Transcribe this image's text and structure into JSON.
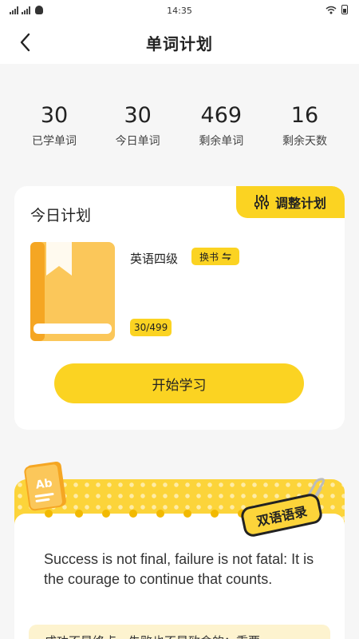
{
  "status_bar": {
    "time": "14:35"
  },
  "header": {
    "title": "单词计划"
  },
  "stats": [
    {
      "value": "30",
      "label": "已学单词"
    },
    {
      "value": "30",
      "label": "今日单词"
    },
    {
      "value": "469",
      "label": "剩余单词"
    },
    {
      "value": "16",
      "label": "剩余天数"
    }
  ],
  "plan": {
    "title": "今日计划",
    "adjust_label": "调整计划",
    "book_name": "英语四级",
    "swap_label": "换书",
    "progress": "30/499",
    "start_label": "开始学习"
  },
  "quote": {
    "tag": "双语语录",
    "english": "Success is not final, failure is not fatal: It is the courage to continue that counts.",
    "chinese": "成功不是终点，失败也不是致命的：重要"
  },
  "colors": {
    "accent": "#fbd322",
    "book_orange": "#f5a623",
    "book_light": "#fbc75a",
    "background": "#f6f6f6"
  }
}
